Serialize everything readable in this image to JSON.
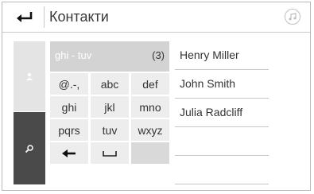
{
  "header": {
    "title": "Контакти"
  },
  "search": {
    "query": "ghi - tuv",
    "count": "(3)"
  },
  "keypad": {
    "rows": [
      [
        "@.-,",
        "abc",
        "def"
      ],
      [
        "ghi",
        "jkl",
        "mno"
      ],
      [
        "pqrs",
        "tuv",
        "wxyz"
      ]
    ]
  },
  "contacts": [
    "Henry Miller",
    "John Smith",
    "Julia Radcliff"
  ],
  "colors": {
    "active_tab": "#4a4a4a",
    "inactive_tab": "#e4e4e4",
    "key_bg": "#ededed",
    "search_field_bg": "#d3d3d3"
  },
  "icons": {
    "back": "back-arrow-icon",
    "music": "music-note-icon",
    "contacts_tab": "person-icon",
    "search_tab": "search-icon",
    "backspace": "backspace-arrow-icon",
    "space": "space-bar-icon"
  }
}
